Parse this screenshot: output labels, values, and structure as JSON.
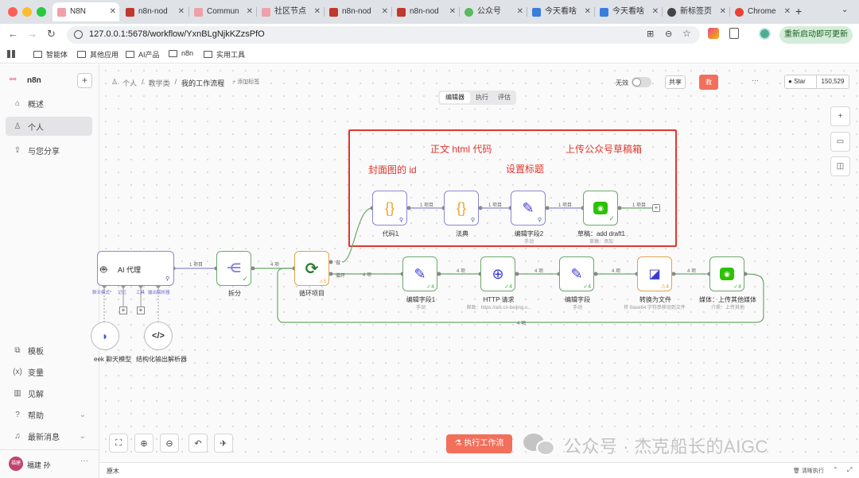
{
  "browser": {
    "tabs": [
      {
        "label": "N8N",
        "active": true
      },
      {
        "label": "n8n-nod"
      },
      {
        "label": "Commun"
      },
      {
        "label": "社区节点"
      },
      {
        "label": "n8n-nod"
      },
      {
        "label": "n8n-nod"
      },
      {
        "label": "公众号"
      },
      {
        "label": "今天看啥"
      },
      {
        "label": "今天看啥"
      },
      {
        "label": "新标签页"
      },
      {
        "label": "Chrome"
      }
    ],
    "url": "127.0.0.1:5678/workflow/YxnBLgNjkKZzsPfO",
    "update_button": "重新启动即可更新",
    "bookmarks": [
      "智能体",
      "其他应用",
      "AI产品",
      "n8n",
      "实用工具"
    ]
  },
  "sidebar": {
    "logo": "n8n",
    "items": [
      "概述",
      "个人",
      "与您分享"
    ],
    "bottom_items": [
      "模板",
      "变量",
      "见解",
      "帮助",
      "最新消息"
    ],
    "user": {
      "avatar": "福建",
      "name": "福建 孙"
    }
  },
  "header": {
    "breadcrumb": [
      "个人",
      "教学类",
      "我的工作流程"
    ],
    "add_tag": "+ 添加标签",
    "tabs": [
      "编辑器",
      "执行",
      "评估"
    ],
    "inactive_label": "无效",
    "share": "共享",
    "save": "救",
    "star": "Star",
    "star_count": "150,529"
  },
  "annotations": {
    "cover": "封面图的 id",
    "html": "正文 html 代码",
    "title": "设置标题",
    "upload": "上传公众号草稿箱"
  },
  "nodes": {
    "ai_agent": {
      "label": "AI 代理",
      "ports": [
        "聊天模式*",
        "记忆",
        "工具",
        "输出解析器"
      ]
    },
    "split": {
      "label": "拆分"
    },
    "loop": {
      "label": "循环项目",
      "warn": "⚠5",
      "out_done": "做",
      "out_loop": "循环"
    },
    "code1": {
      "label": "代码1"
    },
    "code2": {
      "label": "法典"
    },
    "edit2": {
      "label": "编辑字段2",
      "sub": "手动"
    },
    "draft": {
      "label": "草稿：add draft1",
      "sub": "草稿：添加"
    },
    "edit1": {
      "label": "编辑字段1",
      "sub": "手动"
    },
    "http": {
      "label": "HTTP 请求",
      "sub": "邮政：https://ark.cn-beijing.v..."
    },
    "edit": {
      "label": "编辑字段",
      "sub": "手动"
    },
    "tofile": {
      "label": "转换为文件",
      "sub": "将 Base64 字符串移动到文件"
    },
    "media": {
      "label": "媒体：上传其他媒体",
      "sub": "介质：上传其他"
    },
    "deepseek": {
      "label": "eek 聊天模型"
    },
    "parser": {
      "label": "结构化输出解析器"
    }
  },
  "edges": {
    "one_item": "1 项目",
    "four_items": "4 项",
    "count4": "4"
  },
  "execute_button": "执行工作流",
  "watermark": "公众号 · 杰克船长的AIGC",
  "footer": {
    "left": "原木",
    "right": "清晰执行"
  }
}
